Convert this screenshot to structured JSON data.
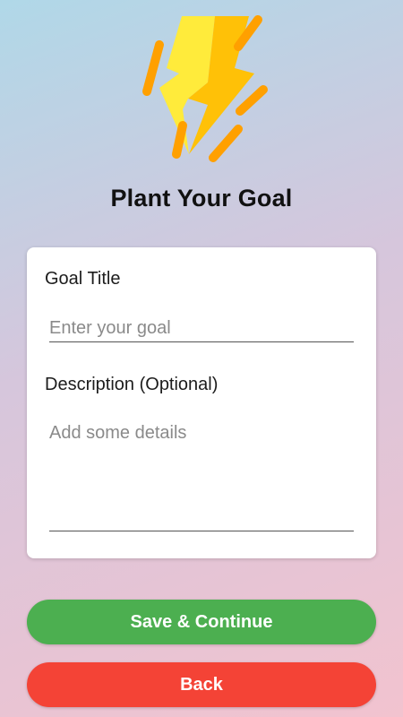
{
  "header": {
    "icon": "lightning-bolt-icon",
    "title": "Plant Your Goal"
  },
  "form": {
    "goal_title_label": "Goal Title",
    "goal_title_placeholder": "Enter your goal",
    "description_label": "Description (Optional)",
    "description_placeholder": "Add some details"
  },
  "buttons": {
    "save_label": "Save & Continue",
    "back_label": "Back"
  },
  "colors": {
    "save_button": "#4caf50",
    "back_button": "#f44336",
    "bolt_light": "#ffeb3b",
    "bolt_dark": "#ffc107",
    "streaks": "#ffa000"
  }
}
